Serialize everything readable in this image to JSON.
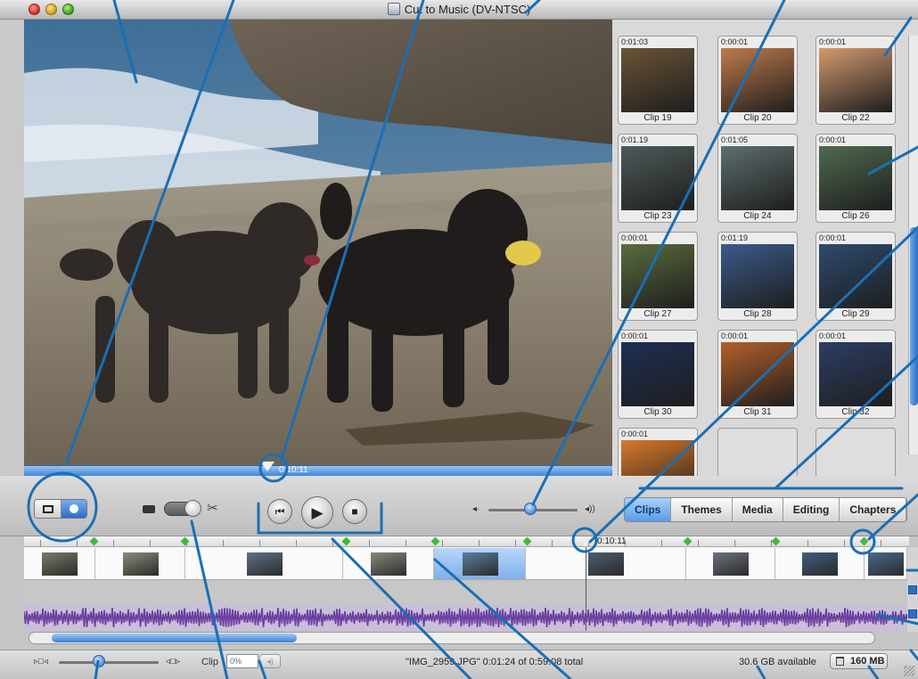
{
  "window": {
    "title": "Cut to Music (DV-NTSC)"
  },
  "viewer": {
    "timecode": "0:10:11"
  },
  "clips": [
    {
      "label": "Clip 19",
      "duration": "0:01:03",
      "thumb_color": "#6a5436"
    },
    {
      "label": "Clip 20",
      "duration": "0:00:01",
      "thumb_color": "#c07a4a"
    },
    {
      "label": "Clip 22",
      "duration": "0:00:01",
      "thumb_color": "#d49a6e"
    },
    {
      "label": "Clip 23",
      "duration": "0:01.19",
      "thumb_color": "#4e5a5a"
    },
    {
      "label": "Clip 24",
      "duration": "0:01:05",
      "thumb_color": "#5d6e6e"
    },
    {
      "label": "Clip 26",
      "duration": "0:00:01",
      "thumb_color": "#4f6a4e"
    },
    {
      "label": "Clip 27",
      "duration": "0:00:01",
      "thumb_color": "#5a6c3e"
    },
    {
      "label": "Clip 28",
      "duration": "0:01:19",
      "thumb_color": "#3b5b8a"
    },
    {
      "label": "Clip 29",
      "duration": "0:00:01",
      "thumb_color": "#2e4a6e"
    },
    {
      "label": "Clip 30",
      "duration": "0:00:01",
      "thumb_color": "#1e2e54"
    },
    {
      "label": "Clip 31",
      "duration": "0:00:01",
      "thumb_color": "#b4602a"
    },
    {
      "label": "Clip 32",
      "duration": "0:00:01",
      "thumb_color": "#2c3e64"
    },
    {
      "label": "",
      "duration": "0:00:01",
      "thumb_color": "#d8782a"
    }
  ],
  "tabs": [
    {
      "label": "Clips",
      "active": true
    },
    {
      "label": "Themes",
      "active": false
    },
    {
      "label": "Media",
      "active": false
    },
    {
      "label": "Editing",
      "active": false
    },
    {
      "label": "Chapters",
      "active": false
    }
  ],
  "timeline": {
    "playhead_time": "0:10:11",
    "clip_volume_label": "Clip",
    "clip_volume_value": "0%",
    "clip_thumbs": [
      "#7a7a6a",
      "#8c8c7c",
      "#5f7285",
      "#8a8a80",
      "#5d7f9e",
      "#4c5e70",
      "#6b7280",
      "#3e5e80",
      "#4a6a8e"
    ]
  },
  "status": {
    "info": "\"IMG_2959.JPG\"  0:01:24 of 0:59:08 total",
    "disk_free": "30.6 GB available",
    "trash_size": "160 MB"
  },
  "icons": {
    "close": "close-icon",
    "minimize": "minimize-icon",
    "zoom": "zoom-icon",
    "rewind": "rewind-icon",
    "play": "play-icon",
    "forward": "fast-forward-icon",
    "volume_low": "volume-low-icon",
    "volume_high": "volume-high-icon",
    "scissors": "scissors-icon",
    "camera": "camera-icon",
    "trash": "trash-icon"
  },
  "colors": {
    "accent": "#3f86d8",
    "callout": "#1a6fb5",
    "audio_wave": "#6b3fa0",
    "marker": "#43b83d"
  }
}
